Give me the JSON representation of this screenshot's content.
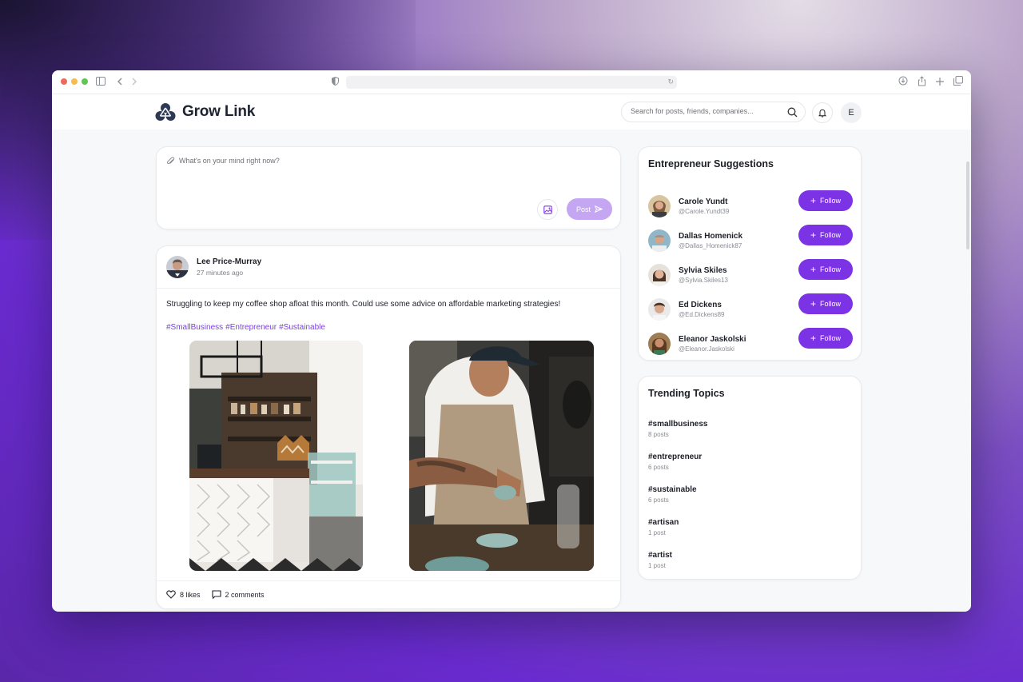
{
  "app": {
    "name": "Grow Link",
    "search_placeholder": "Search for posts, friends, companies...",
    "user_initial": "E"
  },
  "composer": {
    "placeholder": "What's on your mind right now?",
    "post_label": "Post"
  },
  "post": {
    "author": "Lee Price-Murray",
    "time": "27 minutes ago",
    "text": "Struggling to keep my coffee shop afloat this month. Could use some advice on affordable marketing strategies!",
    "tags": [
      "#SmallBusiness",
      "#Entrepreneur",
      "#Sustainable"
    ],
    "likes": "8 likes",
    "comments": "2 comments"
  },
  "suggestions": {
    "title": "Entrepreneur Suggestions",
    "follow_label": "Follow",
    "items": [
      {
        "name": "Carole Yundt",
        "handle": "@Carole.Yundt39"
      },
      {
        "name": "Dallas Homenick",
        "handle": "@Dallas_Homenick87"
      },
      {
        "name": "Sylvia Skiles",
        "handle": "@Sylvia.Skiles13"
      },
      {
        "name": "Ed Dickens",
        "handle": "@Ed.Dickens89"
      },
      {
        "name": "Eleanor Jaskolski",
        "handle": "@Eleanor.Jaskolski"
      }
    ]
  },
  "trending": {
    "title": "Trending Topics",
    "items": [
      {
        "tag": "#smallbusiness",
        "count": "8 posts"
      },
      {
        "tag": "#entrepreneur",
        "count": "6 posts"
      },
      {
        "tag": "#sustainable",
        "count": "6 posts"
      },
      {
        "tag": "#artisan",
        "count": "1 post"
      },
      {
        "tag": "#artist",
        "count": "1 post"
      }
    ]
  },
  "colors": {
    "accent": "#7c33e6",
    "post_button_disabled": "#c4a6f3",
    "hashtag": "#7b3fe4"
  }
}
